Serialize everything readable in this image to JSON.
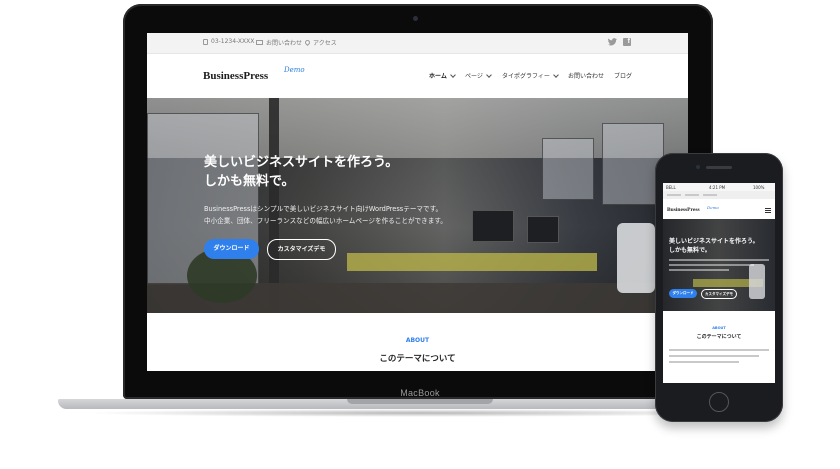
{
  "laptop": {
    "brand_label": "MacBook",
    "site": {
      "topbar": {
        "phone": "03-1234-XXXX",
        "contact": "お問い合わせ",
        "access": "アクセス",
        "social_icons": [
          "twitter-icon",
          "facebook-icon"
        ]
      },
      "header": {
        "logo": "BusinessPress",
        "logo_badge": "Demo",
        "nav": [
          {
            "label": "ホーム",
            "has_dropdown": true,
            "active": true
          },
          {
            "label": "ページ",
            "has_dropdown": true
          },
          {
            "label": "タイポグラフィー",
            "has_dropdown": true
          },
          {
            "label": "お問い合わせ",
            "has_dropdown": false
          },
          {
            "label": "ブログ",
            "has_dropdown": false
          }
        ]
      },
      "hero": {
        "title_line1": "美しいビジネスサイトを作ろう。",
        "title_line2": "しかも無料で。",
        "desc_line1": "BusinessPressはシンプルで美しいビジネスサイト向けWordPressテーマです。",
        "desc_line2": "中小企業、団体、フリーランスなどの幅広いホームページを作ることができます。",
        "primary_button": "ダウンロード",
        "secondary_button": "カスタマイズデモ"
      },
      "about": {
        "label": "ABOUT",
        "title": "このテーマについて"
      }
    }
  },
  "phone": {
    "status": {
      "carrier": "BELL",
      "time": "4:21 PM",
      "battery": "100%"
    },
    "header": {
      "logo": "BusinessPress",
      "logo_badge": "Demo"
    },
    "hero": {
      "title_line1": "美しいビジネスサイトを作ろう。",
      "title_line2": "しかも無料で。",
      "primary_button": "ダウンロード",
      "secondary_button": "カスタマイズデモ"
    },
    "about": {
      "label": "ABOUT",
      "title": "このテーマについて"
    }
  },
  "colors": {
    "accent": "#2f80ed",
    "device_dark": "#1b1c1f"
  }
}
